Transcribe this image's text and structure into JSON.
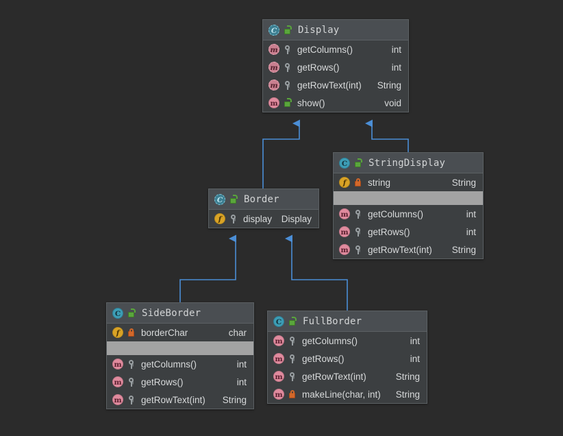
{
  "diagram": {
    "kind": "uml-class-diagram",
    "background": "#2b2b2b",
    "edge_color": "#4b8ed6",
    "selection_color": "#a3a3a3",
    "relation_label": "generalization"
  },
  "classes": {
    "display": {
      "name": "Display",
      "stereotype_icon": "abstract-class-icon",
      "visibility_icon": "public-lock-icon",
      "members": [
        {
          "icon": "abstract-method-icon",
          "visibility": "package-key-icon",
          "name": "getColumns()",
          "type": "int"
        },
        {
          "icon": "abstract-method-icon",
          "visibility": "package-key-icon",
          "name": "getRows()",
          "type": "int"
        },
        {
          "icon": "abstract-method-icon",
          "visibility": "package-key-icon",
          "name": "getRowText(int)",
          "type": "String"
        },
        {
          "icon": "method-icon",
          "visibility": "public-lock-icon",
          "name": "show()",
          "type": "void"
        }
      ]
    },
    "stringdisplay": {
      "name": "StringDisplay",
      "stereotype_icon": "class-icon",
      "visibility_icon": "public-lock-icon",
      "fields": [
        {
          "icon": "field-icon",
          "visibility": "private-lock-icon",
          "name": "string",
          "type": "String"
        }
      ],
      "methods": [
        {
          "icon": "method-icon",
          "visibility": "package-key-icon",
          "name": "getColumns()",
          "type": "int"
        },
        {
          "icon": "method-icon",
          "visibility": "package-key-icon",
          "name": "getRows()",
          "type": "int"
        },
        {
          "icon": "method-icon",
          "visibility": "package-key-icon",
          "name": "getRowText(int)",
          "type": "String"
        }
      ]
    },
    "border": {
      "name": "Border",
      "stereotype_icon": "abstract-class-icon",
      "visibility_icon": "public-lock-icon",
      "fields": [
        {
          "icon": "field-icon",
          "visibility": "package-key-icon",
          "name": "display",
          "type": "Display"
        }
      ]
    },
    "sideborder": {
      "name": "SideBorder",
      "stereotype_icon": "class-icon",
      "visibility_icon": "public-lock-icon",
      "fields": [
        {
          "icon": "field-icon",
          "visibility": "private-lock-icon",
          "name": "borderChar",
          "type": "char"
        }
      ],
      "methods": [
        {
          "icon": "method-icon",
          "visibility": "package-key-icon",
          "name": "getColumns()",
          "type": "int"
        },
        {
          "icon": "method-icon",
          "visibility": "package-key-icon",
          "name": "getRows()",
          "type": "int"
        },
        {
          "icon": "method-icon",
          "visibility": "package-key-icon",
          "name": "getRowText(int)",
          "type": "String"
        }
      ]
    },
    "fullborder": {
      "name": "FullBorder",
      "stereotype_icon": "class-icon",
      "visibility_icon": "public-lock-icon",
      "methods": [
        {
          "icon": "method-icon",
          "visibility": "package-key-icon",
          "name": "getColumns()",
          "type": "int"
        },
        {
          "icon": "method-icon",
          "visibility": "package-key-icon",
          "name": "getRows()",
          "type": "int"
        },
        {
          "icon": "method-icon",
          "visibility": "package-key-icon",
          "name": "getRowText(int)",
          "type": "String"
        },
        {
          "icon": "method-icon",
          "visibility": "private-lock-icon",
          "name": "makeLine(char, int)",
          "type": "String"
        }
      ]
    }
  }
}
